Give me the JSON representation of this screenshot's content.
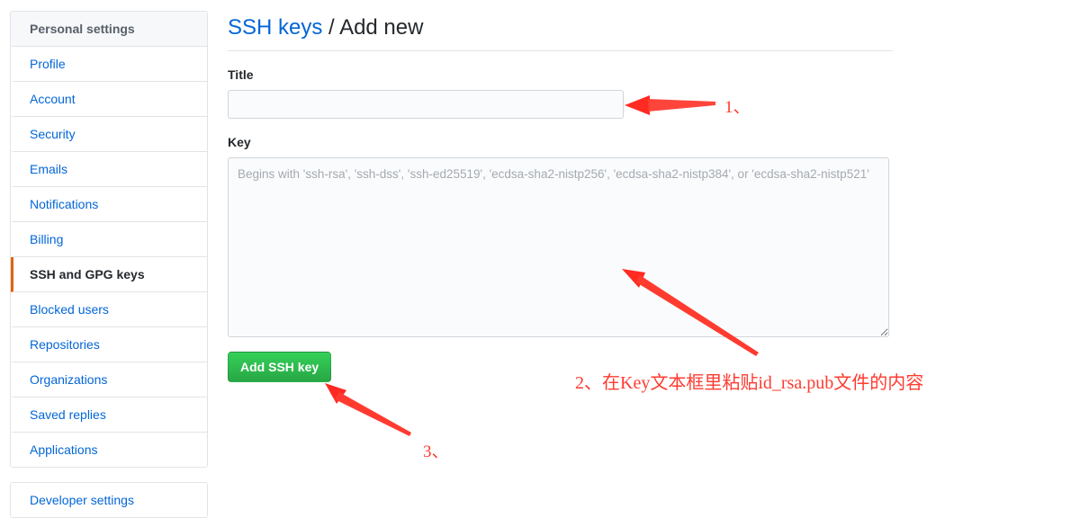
{
  "sidebar": {
    "groups": [
      {
        "name": "personal-settings",
        "items": [
          {
            "label": "Personal settings",
            "kind": "header"
          },
          {
            "label": "Profile",
            "kind": "link"
          },
          {
            "label": "Account",
            "kind": "link"
          },
          {
            "label": "Security",
            "kind": "link"
          },
          {
            "label": "Emails",
            "kind": "link"
          },
          {
            "label": "Notifications",
            "kind": "link"
          },
          {
            "label": "Billing",
            "kind": "link"
          },
          {
            "label": "SSH and GPG keys",
            "kind": "selected"
          },
          {
            "label": "Blocked users",
            "kind": "link"
          },
          {
            "label": "Repositories",
            "kind": "link"
          },
          {
            "label": "Organizations",
            "kind": "link"
          },
          {
            "label": "Saved replies",
            "kind": "link"
          },
          {
            "label": "Applications",
            "kind": "link"
          }
        ]
      },
      {
        "name": "developer-settings",
        "items": [
          {
            "label": "Developer settings",
            "kind": "link"
          }
        ]
      }
    ]
  },
  "header": {
    "breadcrumb_link": "SSH keys",
    "breadcrumb_separator": "/",
    "breadcrumb_current": "Add new"
  },
  "form": {
    "title_label": "Title",
    "title_value": "",
    "title_placeholder": "",
    "key_label": "Key",
    "key_value": "",
    "key_placeholder": "Begins with 'ssh-rsa', 'ssh-dss', 'ssh-ed25519', 'ecdsa-sha2-nistp256', 'ecdsa-sha2-nistp384', or 'ecdsa-sha2-nistp521'",
    "submit_label": "Add SSH key"
  },
  "annotations": {
    "step1": "1、",
    "step2": "2、在Key文本框里粘贴id_rsa.pub文件的内容",
    "step3": "3、",
    "color": "#ff3b30"
  },
  "colors": {
    "link": "#0366d6",
    "active_marker": "#e36209",
    "button_green": "#28a745",
    "border": "#e1e4e8",
    "annotation_red": "#ff3b30"
  }
}
